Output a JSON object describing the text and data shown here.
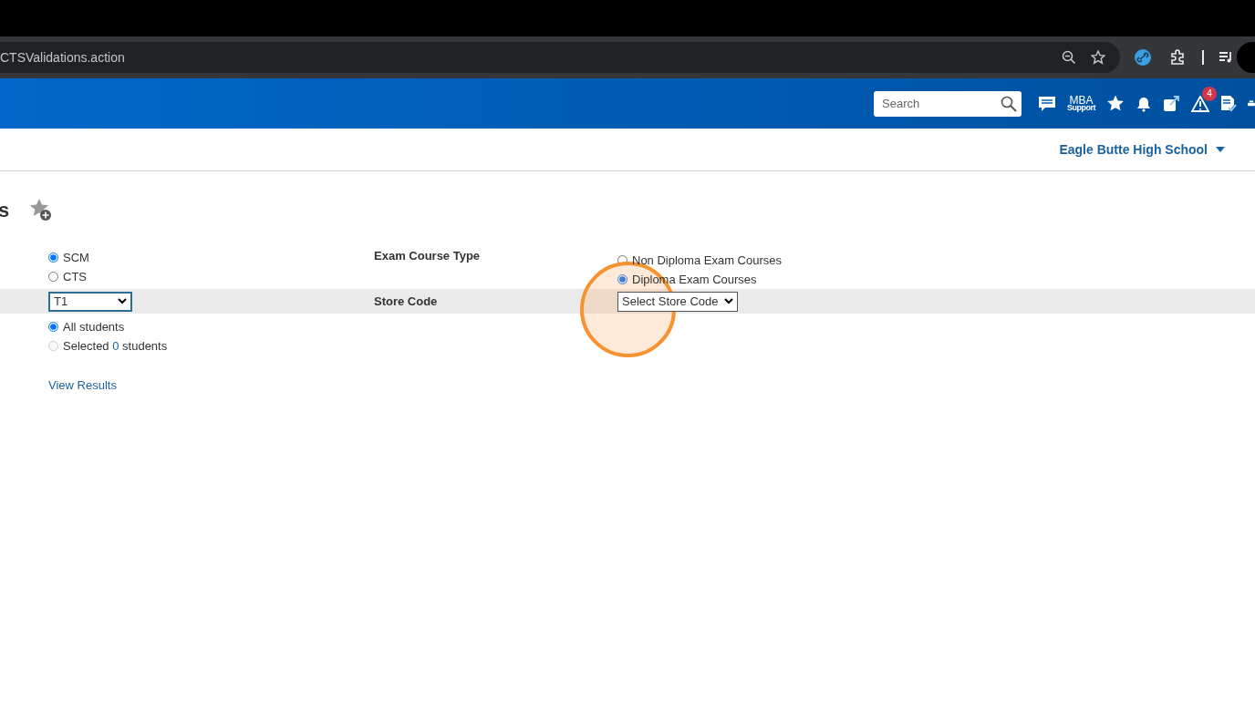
{
  "browser": {
    "url": "CTSValidations.action"
  },
  "header": {
    "search": {
      "placeholder": "Search"
    },
    "support": {
      "line1": "MBA",
      "line2": "Support"
    },
    "alert_count": "4"
  },
  "school": "Eagle Butte High School",
  "page_title": "s",
  "form": {
    "course_source": [
      {
        "label": "SCM",
        "selected": true
      },
      {
        "label": "CTS",
        "selected": false
      }
    ],
    "exam_course_type": {
      "label": "Exam Course Type",
      "options": [
        {
          "label": "Non Diploma Exam Courses",
          "selected": false
        },
        {
          "label": "Diploma Exam Courses",
          "selected": true
        }
      ]
    },
    "term": {
      "value": "T1"
    },
    "store_code": {
      "label": "Store Code",
      "value": "Select Store Code"
    },
    "students": [
      {
        "label": "All students",
        "selected": true,
        "disabled": false
      },
      {
        "label": "Selected",
        "count": "0",
        "suffix": "students",
        "selected": false,
        "disabled": true
      }
    ],
    "link": "View Results"
  }
}
